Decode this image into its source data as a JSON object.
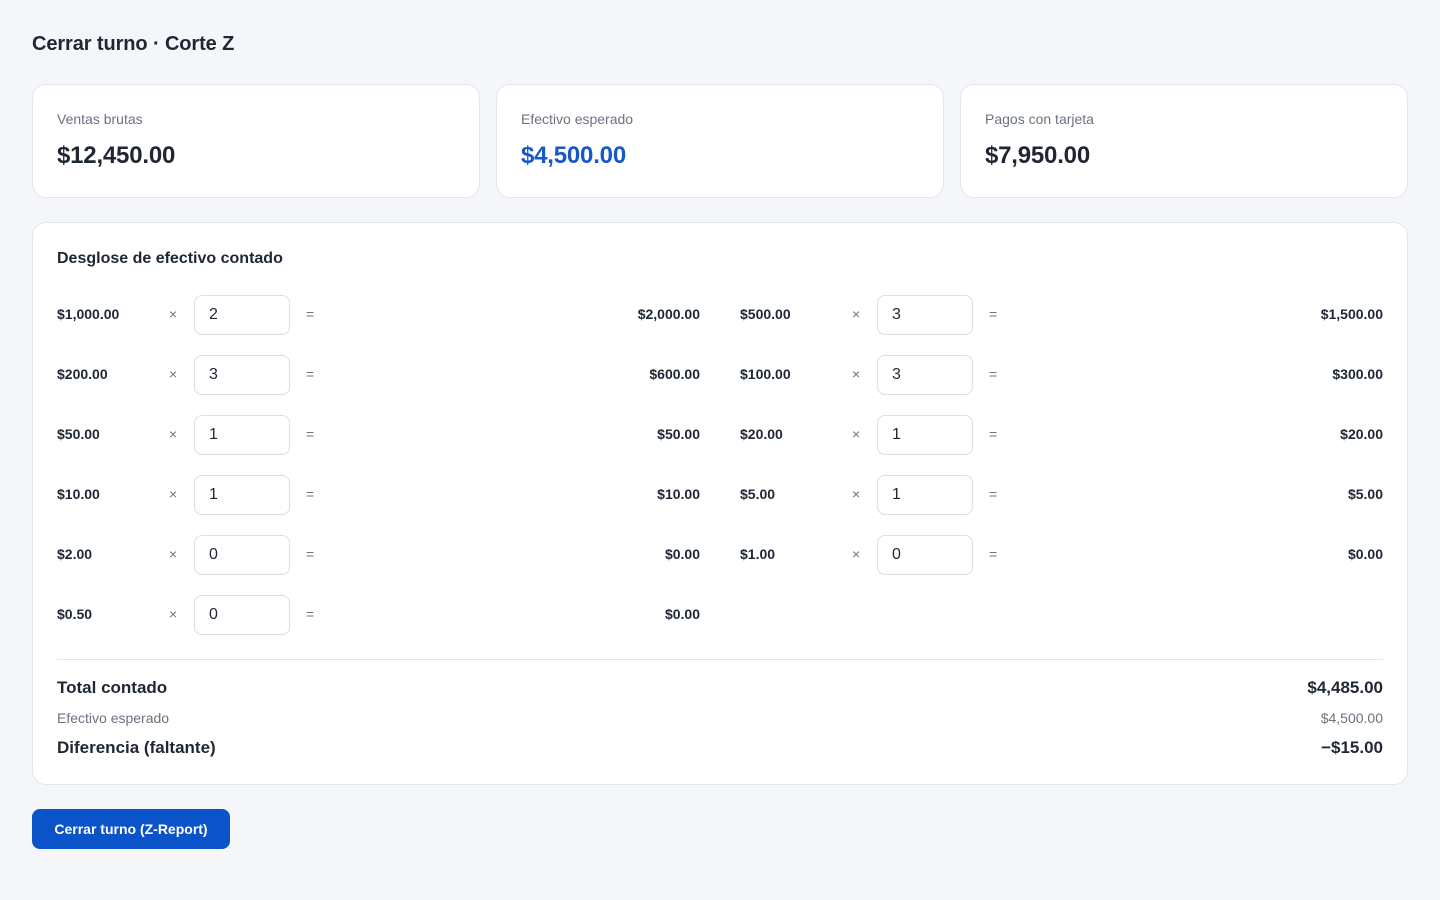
{
  "page": {
    "title": "Cerrar turno · Corte Z"
  },
  "summary_cards": [
    {
      "label": "Ventas brutas",
      "value": "$12,450.00"
    },
    {
      "label": "Efectivo esperado",
      "value": "$4,500.00"
    },
    {
      "label": "Pagos con tarjeta",
      "value": "$7,950.00"
    }
  ],
  "breakdown": {
    "title": "Desglose de efectivo contado",
    "times_symbol": "×",
    "equals_symbol": "=",
    "rows": [
      {
        "denomination": "$1,000.00",
        "count": "2",
        "subtotal": "$2,000.00"
      },
      {
        "denomination": "$500.00",
        "count": "3",
        "subtotal": "$1,500.00"
      },
      {
        "denomination": "$200.00",
        "count": "3",
        "subtotal": "$600.00"
      },
      {
        "denomination": "$100.00",
        "count": "3",
        "subtotal": "$300.00"
      },
      {
        "denomination": "$50.00",
        "count": "1",
        "subtotal": "$50.00"
      },
      {
        "denomination": "$20.00",
        "count": "1",
        "subtotal": "$20.00"
      },
      {
        "denomination": "$10.00",
        "count": "1",
        "subtotal": "$10.00"
      },
      {
        "denomination": "$5.00",
        "count": "1",
        "subtotal": "$5.00"
      },
      {
        "denomination": "$2.00",
        "count": "0",
        "subtotal": "$0.00"
      },
      {
        "denomination": "$1.00",
        "count": "0",
        "subtotal": "$0.00"
      },
      {
        "denomination": "$0.50",
        "count": "0",
        "subtotal": "$0.00"
      }
    ]
  },
  "totals": {
    "counted_label": "Total contado",
    "counted_value": "$4,485.00",
    "expected_label": "Efectivo esperado",
    "expected_value": "$4,500.00",
    "difference_label": "Diferencia (faltante)",
    "difference_value": "−$15.00"
  },
  "actions": {
    "close_shift_label": "Cerrar turno (Z-Report)"
  },
  "colors": {
    "accent": "#1657c9",
    "button": "#0b53c9",
    "background": "#f5f6fa"
  }
}
